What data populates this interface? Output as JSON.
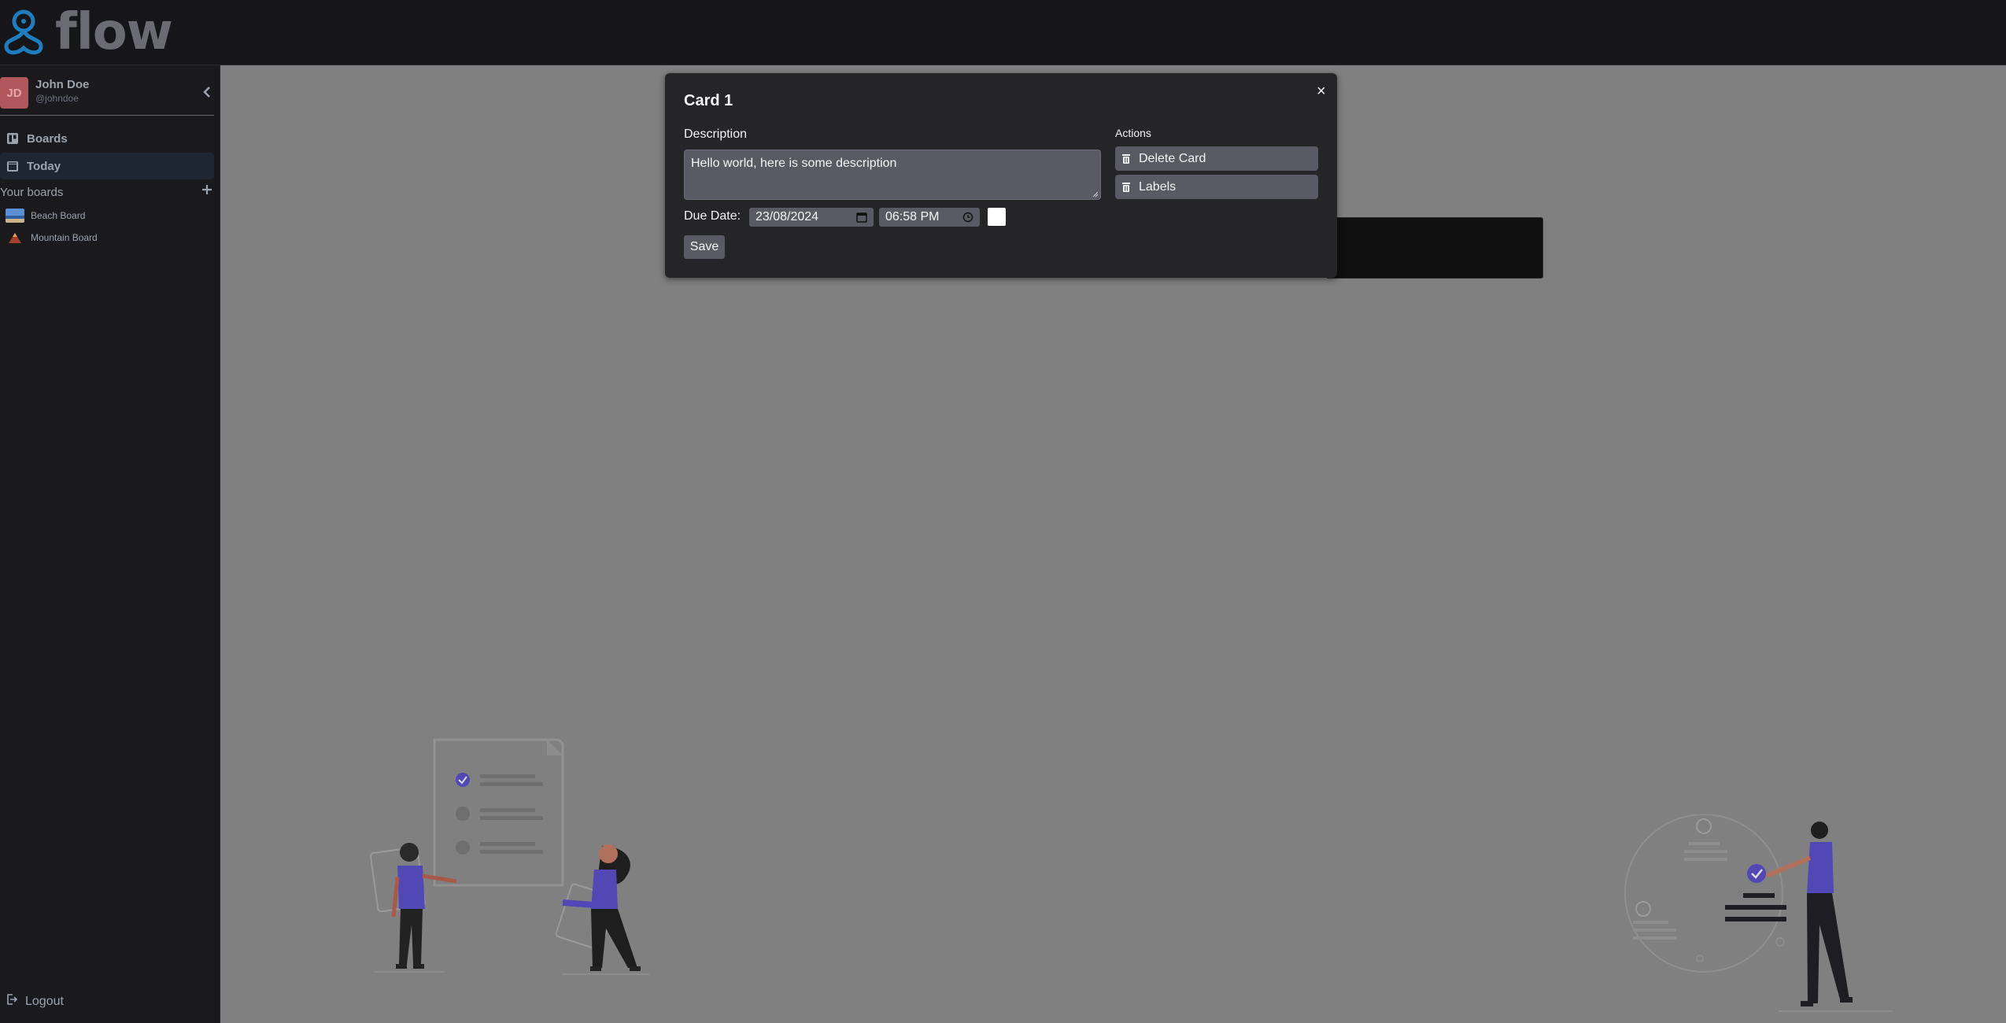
{
  "app": {
    "name": "flow"
  },
  "user": {
    "initials": "JD",
    "name": "John Doe",
    "handle": "@johndoe"
  },
  "sidebar": {
    "nav": [
      {
        "label": "Boards",
        "icon": "boards-icon"
      },
      {
        "label": "Today",
        "icon": "calendar-icon",
        "active": true
      }
    ],
    "section_title": "Your boards",
    "boards": [
      {
        "label": "Beach Board"
      },
      {
        "label": "Mountain Board"
      }
    ],
    "logout_label": "Logout"
  },
  "modal": {
    "title": "Card 1",
    "close_symbol": "×",
    "description_label": "Description",
    "description_value": "Hello world, here is some description",
    "due_date_label": "Due Date:",
    "due_date_value": "23/08/2024",
    "due_time_value": "06:58 PM",
    "due_color": "#ffffff",
    "save_label": "Save",
    "actions_label": "Actions",
    "actions": [
      {
        "label": "Delete Card",
        "icon": "trash-icon"
      },
      {
        "label": "Labels",
        "icon": "trash-icon"
      }
    ]
  },
  "colors": {
    "accent": "#6c63ff",
    "logo_blue": "#1f7dbf",
    "overlay": "#808080"
  }
}
